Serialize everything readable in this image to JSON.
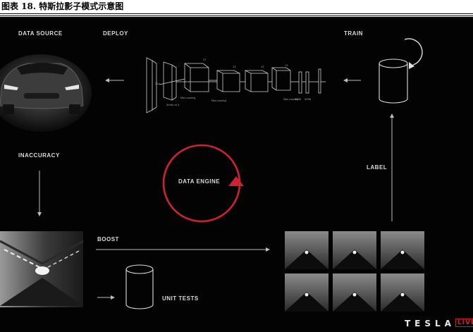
{
  "caption": "图表 18. 特斯拉影子模式示意图",
  "labels": {
    "data_source": "DATA SOURCE",
    "deploy": "DEPLOY",
    "train": "TRAIN",
    "inaccuracy": "INACCURACY",
    "label": "LABEL",
    "data_engine": "DATA ENGINE",
    "boost": "BOOST",
    "unit_tests": "UNIT TESTS"
  },
  "brand": {
    "name": "TESLA",
    "tag": "LIVE"
  },
  "colors": {
    "background": "#030303",
    "text": "#d9d9d9",
    "accent": "#cc2233"
  },
  "icons": [
    "car-image",
    "neural-network-diagram",
    "database-cylinder-icon",
    "cycle-arrow-icon",
    "tunnel-image",
    "tunnel-thumbnail-grid"
  ]
}
